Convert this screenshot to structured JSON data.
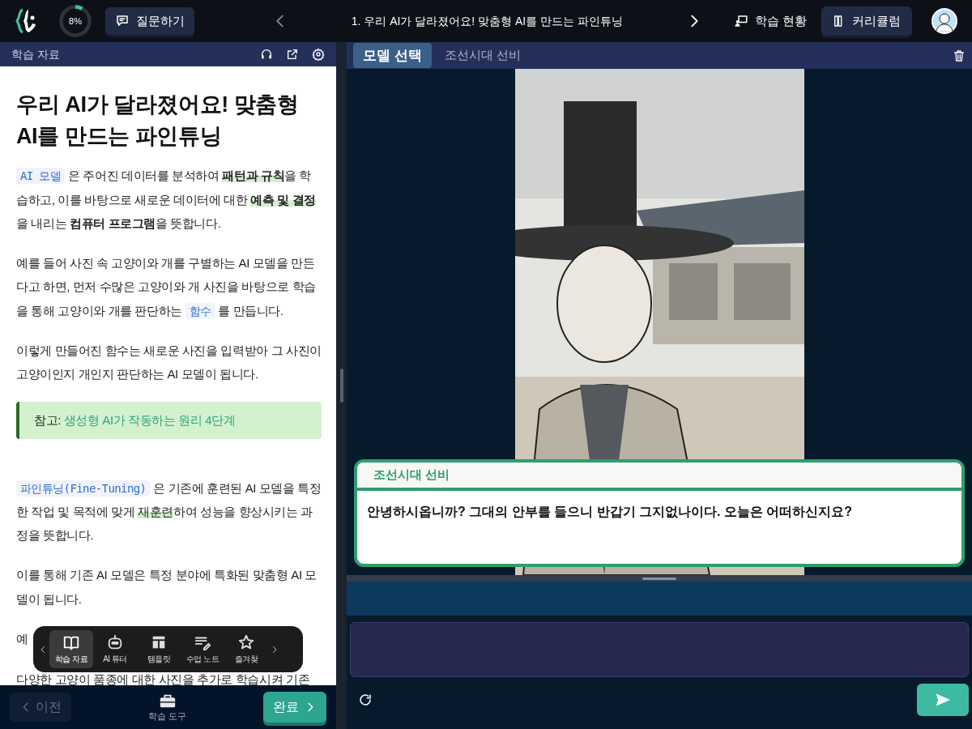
{
  "top_bar": {
    "progress": {
      "text": "8%",
      "level": 0.08
    },
    "ask_button": "질문하기",
    "lesson_title": "1. 우리 AI가 달라졌어요! 맞춤형 AI를 만드는 파인튜닝",
    "status_link": "학습 현황",
    "curriculum_button": "커리큘럼"
  },
  "left_panel": {
    "header_title": "학습 자료",
    "heading": "우리 AI가 달라졌어요! 맞춤형 AI를 만드는 파인튜닝",
    "blocks": [
      {
        "kind": "paragraph",
        "segments": [
          {
            "kind": "code",
            "text": "AI 모델"
          },
          {
            "kind": "text",
            "text": " 은 주어진 데이터를 분석하여 "
          },
          {
            "kind": "mark",
            "text": "패턴과 규칙"
          },
          {
            "kind": "text",
            "text": "을 학습하고, 이를 바탕으로 새로운 데이터에 대한 "
          },
          {
            "kind": "mark",
            "text": "예측 및 결정"
          },
          {
            "kind": "text",
            "text": "을 내리는 "
          },
          {
            "kind": "bold",
            "text": "컴퓨터 프로그램"
          },
          {
            "kind": "text",
            "text": "을 뜻합니다."
          }
        ]
      },
      {
        "kind": "paragraph",
        "segments": [
          {
            "kind": "text",
            "text": "예를 들어 사진 속 고양이와 개를 구별하는 AI 모델을 만든다고 하면, 먼저 수많은 고양이와 개 사진을 바탕으로 학습을 통해 고양이와 개를 판단하는 "
          },
          {
            "kind": "code",
            "text": "함수"
          },
          {
            "kind": "text",
            "text": " 를 만듭니다."
          }
        ]
      },
      {
        "kind": "paragraph",
        "segments": [
          {
            "kind": "text",
            "text": "이렇게 만들어진 함수는 새로운 사진을 입력받아 그 사진이 고양이인지 개인지 판단하는 AI 모델이 됩니다."
          }
        ]
      },
      {
        "kind": "callout",
        "label": "참고:",
        "link": "생성형 AI가 작동하는 원리 4단계"
      },
      {
        "kind": "paragraph",
        "segments": [
          {
            "kind": "code",
            "text": "파인튜닝(Fine-Tuning)"
          },
          {
            "kind": "text",
            "text": " 은 기존에 훈련된 AI 모델을 특정한 작업 및 목적에 맞게 "
          },
          {
            "kind": "highlight",
            "text": "재훈련"
          },
          {
            "kind": "text",
            "text": "하여 성능을 향상시키는 과정을 뜻합니다."
          }
        ]
      },
      {
        "kind": "paragraph",
        "segments": [
          {
            "kind": "text",
            "text": "이를 통해 기존 AI 모델은 특정 분야에 특화된 맞춤형 AI 모델이 됩니다."
          }
        ]
      },
      {
        "kind": "paragraph",
        "segments": [
          {
            "kind": "text",
            "text": "예"
          }
        ]
      },
      {
        "kind": "paragraph",
        "segments": [
          {
            "kind": "text",
            "text": "다양한 고양이 품종에 대한 사진을 추가로 학습시켜 기존"
          }
        ]
      }
    ],
    "tool_dock": [
      {
        "kind": "book",
        "label": "학습 자료",
        "selected": true
      },
      {
        "kind": "robot",
        "label": "AI 튜터",
        "selected": false
      },
      {
        "kind": "template",
        "label": "템플릿",
        "selected": false
      },
      {
        "kind": "notes",
        "label": "수업 노트",
        "selected": false
      },
      {
        "kind": "star",
        "label": "즐겨찾",
        "selected": false
      }
    ],
    "footer": {
      "prev_button": "이전",
      "tools_button": "학습 도구",
      "done_button": "완료"
    }
  },
  "right_panel": {
    "tabs": [
      {
        "label": "모델 선택",
        "selected": true
      },
      {
        "label": "조선시대 선비",
        "selected": false
      }
    ],
    "dialog": {
      "speaker": "조선시대 선비",
      "message": "안녕하시옵니까? 그대의 안부를 들으니 반갑기 그지없나이다. 오늘은 어떠하신지요?"
    }
  }
}
